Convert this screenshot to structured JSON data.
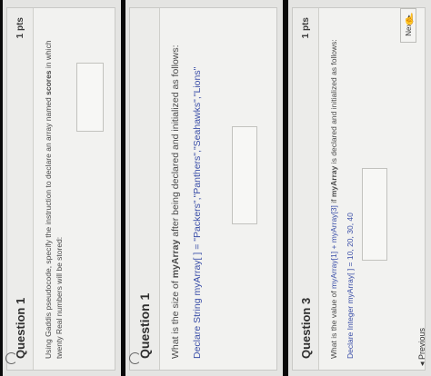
{
  "panels": [
    {
      "title": "Question 1",
      "points": "1 pts",
      "prompt_prefix": "Using Gaddis pseudocode, specify the instruction to declare an array named ",
      "prompt_bold": "scores",
      "prompt_suffix": " in which twenty Real numbers will be stored:"
    },
    {
      "title": "Question 1",
      "prompt_prefix": "What is the size of ",
      "prompt_bold": "myArray",
      "prompt_suffix": " after being declared and initialized as follows:",
      "code": "Declare String myArray[ ] = \"Packers\",\"Panthers\",\"Seahawks\",\"Lions\""
    },
    {
      "title": "Question 3",
      "points": "1 pts",
      "prompt_prefix": "What is the value of ",
      "prompt_blue": "myArray[1] + myArray[3]",
      "prompt_mid": " if ",
      "prompt_bold": "myArray",
      "prompt_suffix": " is declared and initialized as follows:",
      "code": "Declare Integer myArray[ ] = 10, 20, 30, 40",
      "next_label": "Next",
      "next_glyph": "▸",
      "previous_label": "◂ Previous"
    }
  ]
}
